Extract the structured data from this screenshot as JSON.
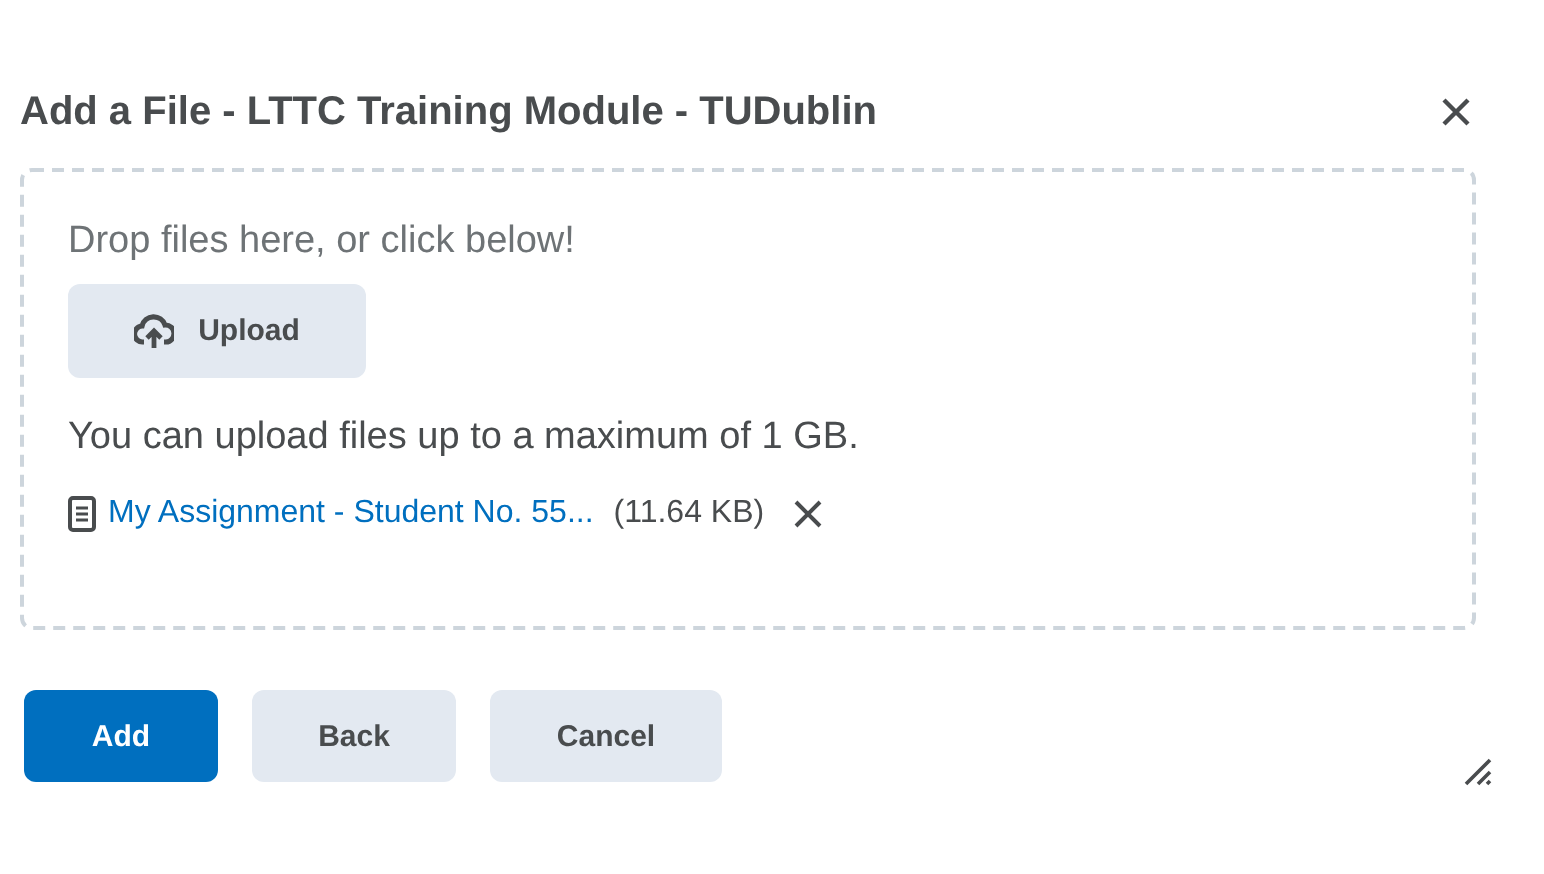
{
  "dialog": {
    "title": "Add a File - LTTC Training Module - TUDublin"
  },
  "dropzone": {
    "prompt": "Drop files here, or click below!",
    "upload_button": "Upload",
    "limit_note": "You can upload files up to a maximum of 1 GB."
  },
  "files": [
    {
      "name": "My Assignment - Student No. 55...",
      "size": "(11.64 KB)"
    }
  ],
  "buttons": [
    {
      "label": "Add",
      "kind": "primary"
    },
    {
      "label": "Back",
      "kind": "secondary"
    },
    {
      "label": "Cancel",
      "kind": "secondary"
    }
  ]
}
